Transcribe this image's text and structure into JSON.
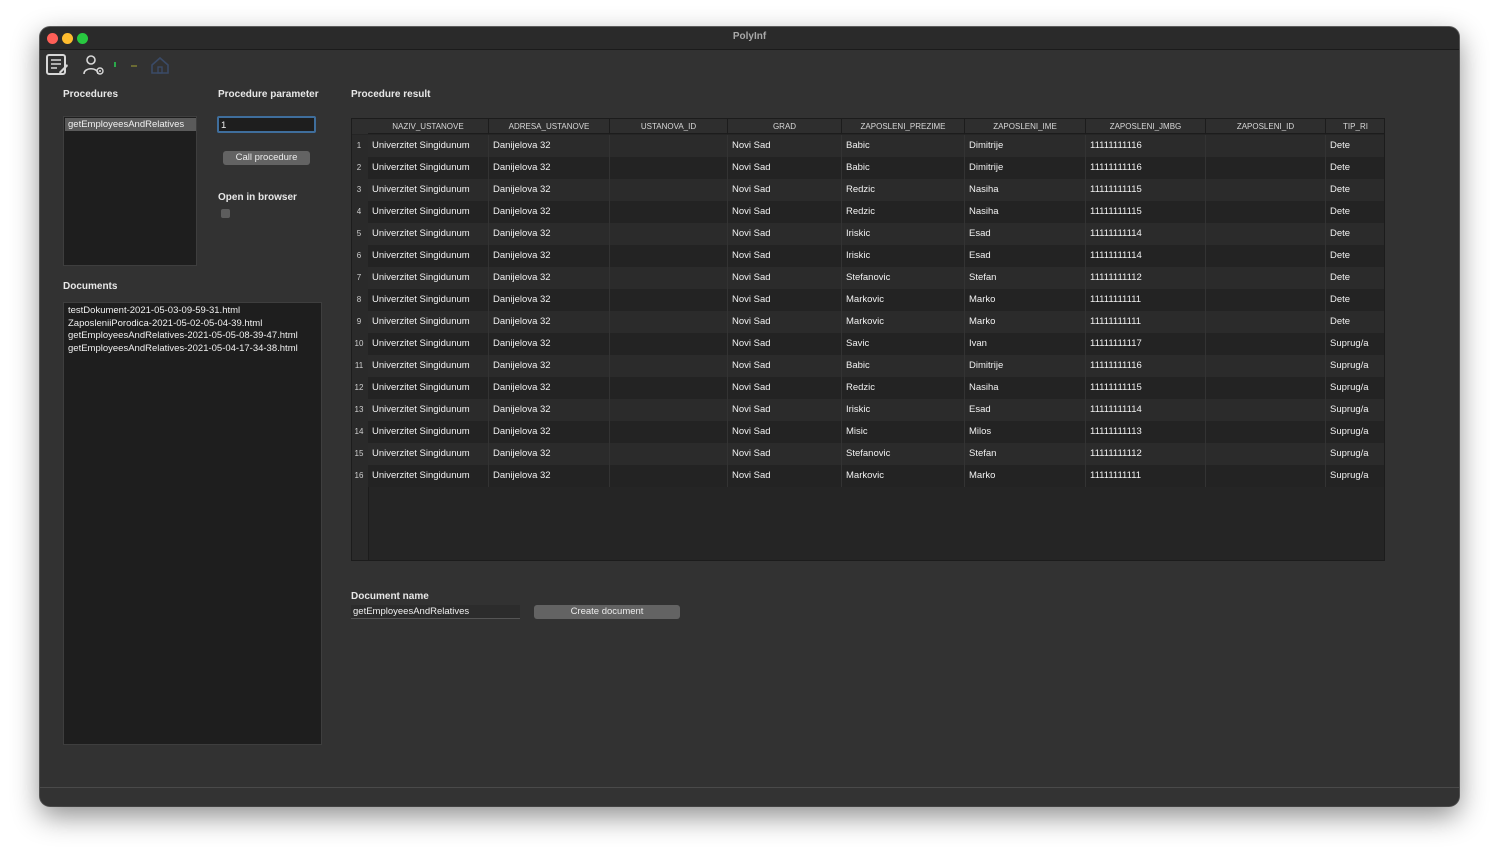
{
  "window": {
    "title": "PolyInf"
  },
  "toolbar": {
    "icons": [
      "document-list-icon",
      "user-settings-icon",
      "green-status-icon",
      "yellow-status-icon",
      "home-icon"
    ]
  },
  "procedures": {
    "label": "Procedures",
    "items": [
      "getEmployeesAndRelatives"
    ]
  },
  "parameter": {
    "label": "Procedure parameter",
    "value": "1",
    "call_label": "Call procedure",
    "open_browser_label": "Open in browser"
  },
  "documents": {
    "label": "Documents",
    "items": [
      "testDokument-2021-05-03-09-59-31.html",
      "ZaposleniiPorodica-2021-05-02-05-04-39.html",
      "getEmployeesAndRelatives-2021-05-05-08-39-47.html",
      "getEmployeesAndRelatives-2021-05-04-17-34-38.html"
    ]
  },
  "result": {
    "label": "Procedure result",
    "columns": [
      "NAZIV_USTANOVE",
      "ADRESA_USTANOVE",
      "USTANOVA_ID",
      "GRAD",
      "ZAPOSLENI_PREZIME",
      "ZAPOSLENI_IME",
      "ZAPOSLENI_JMBG",
      "ZAPOSLENI_ID",
      "TIP_RI"
    ],
    "rows": [
      [
        "1",
        "Univerzitet Singidunum",
        "Danijelova 32",
        "",
        "Novi Sad",
        "Babic",
        "Dimitrije",
        "11111111116",
        "",
        "Dete"
      ],
      [
        "2",
        "Univerzitet Singidunum",
        "Danijelova 32",
        "",
        "Novi Sad",
        "Babic",
        "Dimitrije",
        "11111111116",
        "",
        "Dete"
      ],
      [
        "3",
        "Univerzitet Singidunum",
        "Danijelova 32",
        "",
        "Novi Sad",
        "Redzic",
        "Nasiha",
        "11111111115",
        "",
        "Dete"
      ],
      [
        "4",
        "Univerzitet Singidunum",
        "Danijelova 32",
        "",
        "Novi Sad",
        "Redzic",
        "Nasiha",
        "11111111115",
        "",
        "Dete"
      ],
      [
        "5",
        "Univerzitet Singidunum",
        "Danijelova 32",
        "",
        "Novi Sad",
        "Iriskic",
        "Esad",
        "11111111114",
        "",
        "Dete"
      ],
      [
        "6",
        "Univerzitet Singidunum",
        "Danijelova 32",
        "",
        "Novi Sad",
        "Iriskic",
        "Esad",
        "11111111114",
        "",
        "Dete"
      ],
      [
        "7",
        "Univerzitet Singidunum",
        "Danijelova 32",
        "",
        "Novi Sad",
        "Stefanovic",
        "Stefan",
        "11111111112",
        "",
        "Dete"
      ],
      [
        "8",
        "Univerzitet Singidunum",
        "Danijelova 32",
        "",
        "Novi Sad",
        "Markovic",
        "Marko",
        "11111111111",
        "",
        "Dete"
      ],
      [
        "9",
        "Univerzitet Singidunum",
        "Danijelova 32",
        "",
        "Novi Sad",
        "Markovic",
        "Marko",
        "11111111111",
        "",
        "Dete"
      ],
      [
        "10",
        "Univerzitet Singidunum",
        "Danijelova 32",
        "",
        "Novi Sad",
        "Savic",
        "Ivan",
        "11111111117",
        "",
        "Suprug/a"
      ],
      [
        "11",
        "Univerzitet Singidunum",
        "Danijelova 32",
        "",
        "Novi Sad",
        "Babic",
        "Dimitrije",
        "11111111116",
        "",
        "Suprug/a"
      ],
      [
        "12",
        "Univerzitet Singidunum",
        "Danijelova 32",
        "",
        "Novi Sad",
        "Redzic",
        "Nasiha",
        "11111111115",
        "",
        "Suprug/a"
      ],
      [
        "13",
        "Univerzitet Singidunum",
        "Danijelova 32",
        "",
        "Novi Sad",
        "Iriskic",
        "Esad",
        "11111111114",
        "",
        "Suprug/a"
      ],
      [
        "14",
        "Univerzitet Singidunum",
        "Danijelova 32",
        "",
        "Novi Sad",
        "Misic",
        "Milos",
        "11111111113",
        "",
        "Suprug/a"
      ],
      [
        "15",
        "Univerzitet Singidunum",
        "Danijelova 32",
        "",
        "Novi Sad",
        "Stefanovic",
        "Stefan",
        "11111111112",
        "",
        "Suprug/a"
      ],
      [
        "16",
        "Univerzitet Singidunum",
        "Danijelova 32",
        "",
        "Novi Sad",
        "Markovic",
        "Marko",
        "11111111111",
        "",
        "Suprug/a"
      ]
    ]
  },
  "document": {
    "name_label": "Document name",
    "name_value": "getEmployeesAndRelatives",
    "create_label": "Create document"
  }
}
